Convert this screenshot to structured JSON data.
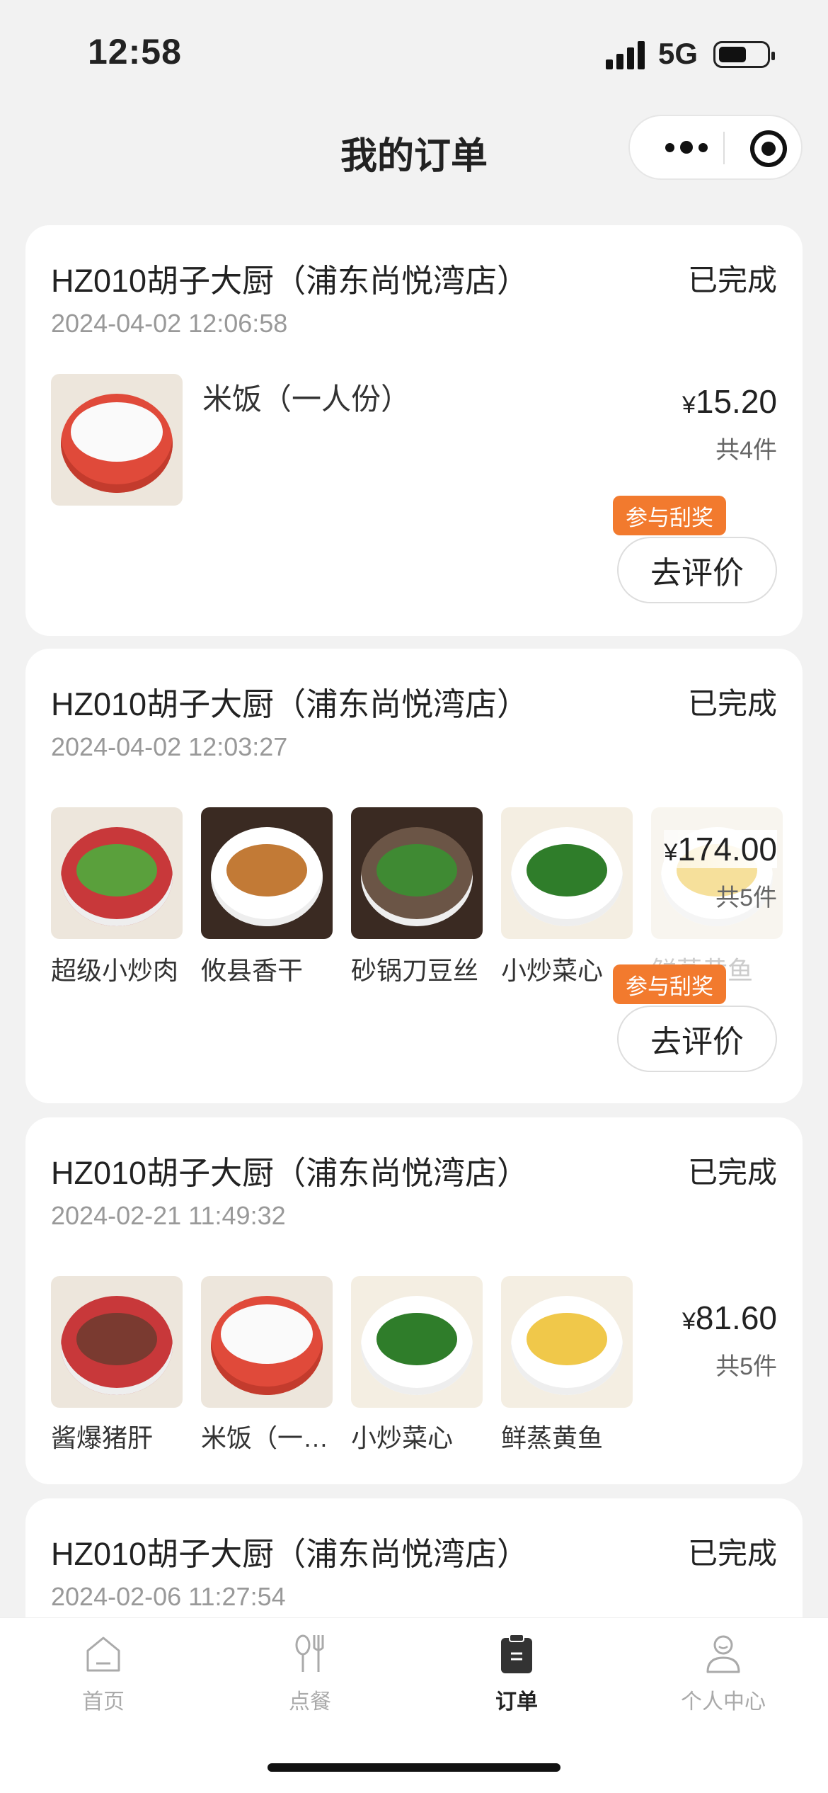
{
  "status_bar": {
    "time": "12:58",
    "network": "5G"
  },
  "header": {
    "title": "我的订单"
  },
  "orders": [
    {
      "store": "HZ010胡子大厨（浦东尚悦湾店）",
      "status": "已完成",
      "time": "2024-04-02 12:06:58",
      "item_title": "米饭（一人份）",
      "price": "15.20",
      "currency": "¥",
      "count": "共4件",
      "tag": "参与刮奖",
      "action": "去评价"
    },
    {
      "store": "HZ010胡子大厨（浦东尚悦湾店）",
      "status": "已完成",
      "time": "2024-04-02 12:03:27",
      "items": [
        "超级小炒肉",
        "攸县香干",
        "砂锅刀豆丝",
        "小炒菜心",
        "鲜蒸黄鱼"
      ],
      "price": "174.00",
      "currency": "¥",
      "count": "共5件",
      "tag": "参与刮奖",
      "action": "去评价"
    },
    {
      "store": "HZ010胡子大厨（浦东尚悦湾店）",
      "status": "已完成",
      "time": "2024-02-21 11:49:32",
      "items": [
        "酱爆猪肝",
        "米饭（一…",
        "小炒菜心",
        "鲜蒸黄鱼"
      ],
      "price": "81.60",
      "currency": "¥",
      "count": "共5件"
    },
    {
      "store": "HZ010胡子大厨（浦东尚悦湾店）",
      "status": "已完成",
      "time": "2024-02-06 11:27:54"
    }
  ],
  "tabbar": [
    {
      "label": "首页",
      "icon": "home-icon"
    },
    {
      "label": "点餐",
      "icon": "fork-spoon-icon"
    },
    {
      "label": "订单",
      "icon": "order-clipboard-icon",
      "active": true
    },
    {
      "label": "个人中心",
      "icon": "user-icon"
    }
  ],
  "colors": {
    "accent": "#f27a2e",
    "background": "#f2f2f2"
  }
}
